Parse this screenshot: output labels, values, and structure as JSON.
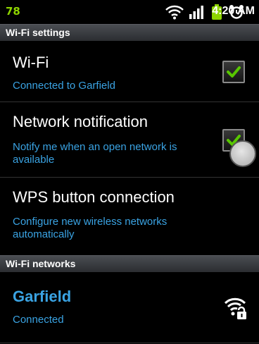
{
  "status_bar": {
    "battery_percent": "78",
    "time": "4:20 AM",
    "icons": [
      "wifi-icon",
      "signal-icon",
      "battery-icon",
      "alarm-icon"
    ]
  },
  "sections": {
    "wifi_settings": "Wi-Fi settings",
    "wifi_networks": "Wi-Fi networks"
  },
  "wifi": {
    "title": "Wi-Fi",
    "summary": "Connected to Garfield",
    "checked": true
  },
  "network_notification": {
    "title": "Network notification",
    "summary": "Notify me when an open network is available",
    "checked": true
  },
  "wps": {
    "title": "WPS button connection",
    "summary": "Configure new wireless networks automatically"
  },
  "networks": [
    {
      "ssid": "Garfield",
      "status": "Connected",
      "icon": "wifi-locked-icon"
    }
  ],
  "colors": {
    "accent": "#3aa3e3",
    "check": "#58c700",
    "battery_text": "#8ed500",
    "header_bg": "#3c3f44"
  }
}
